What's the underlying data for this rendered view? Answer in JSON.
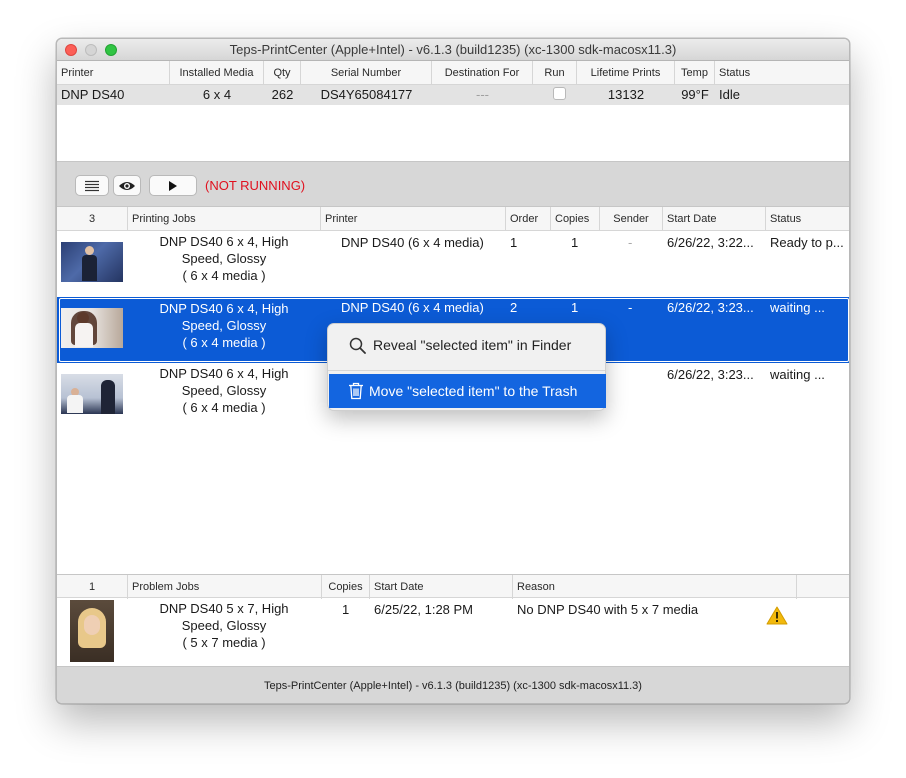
{
  "window": {
    "title": "Teps-PrintCenter (Apple+Intel) - v6.1.3  (build1235)  (xc-1300 sdk-macosx11.3)"
  },
  "printers_table": {
    "headers": [
      "Printer",
      "Installed Media",
      "Qty",
      "Serial Number",
      "Destination For",
      "Run",
      "Lifetime Prints",
      "Temp",
      "Status"
    ],
    "row": {
      "printer": "DNP DS40",
      "media": "6 x 4",
      "qty": "262",
      "serial": "DS4Y65084177",
      "destination": "---",
      "run": false,
      "lifetime": "13132",
      "temp": "99°F",
      "status": "Idle"
    }
  },
  "toolbar": {
    "list_icon": "list-icon",
    "eye_icon": "eye-icon",
    "play_icon": "play-icon",
    "status_text": "(NOT RUNNING)",
    "status_color": "#e0101e"
  },
  "jobs_table": {
    "count": "3",
    "headers": [
      "Printing Jobs",
      "Printer",
      "Order",
      "Copies",
      "Sender",
      "Start Date",
      "Status"
    ],
    "rows": [
      {
        "line1": "DNP DS40 6 x 4, High",
        "line2": "Speed, Glossy",
        "line3": "( 6 x 4 media )",
        "printer": "DNP DS40 (6 x 4 media)",
        "order": "1",
        "copies": "1",
        "sender": "-",
        "start": "6/26/22, 3:22...",
        "status": "Ready to p..."
      },
      {
        "line1": "DNP DS40 6 x 4, High",
        "line2": "Speed, Glossy",
        "line3": "( 6 x 4 media )",
        "printer": "DNP DS40 (6 x 4 media)",
        "order": "2",
        "copies": "1",
        "sender": "-",
        "start": "6/26/22, 3:23...",
        "status": "waiting ..."
      },
      {
        "line1": "DNP DS40 6 x 4, High",
        "line2": "Speed, Glossy",
        "line3": "( 6 x 4 media )",
        "start": "6/26/22, 3:23...",
        "status": "waiting ..."
      }
    ]
  },
  "context_menu": {
    "reveal_icon": "magnifier-icon",
    "reveal_label": "Reveal \"selected item\" in Finder",
    "trash_icon": "trash-icon",
    "trash_label": "Move \"selected item\" to the Trash"
  },
  "problems_table": {
    "count": "1",
    "headers": [
      "Problem Jobs",
      "Copies",
      "Start Date",
      "Reason"
    ],
    "row": {
      "line1": "DNP DS40 5 x 7, High",
      "line2": "Speed, Glossy",
      "line3": "( 5 x 7 media )",
      "copies": "1",
      "start": "6/25/22, 1:28 PM",
      "reason": "No DNP DS40 with 5 x 7 media",
      "warning_icon": "warning-icon"
    }
  },
  "footer": {
    "text": "Teps-PrintCenter (Apple+Intel) - v6.1.3  (build1235)  (xc-1300 sdk-macosx11.3)"
  },
  "colors": {
    "selection": "#0c5bd6",
    "menu_highlight": "#1365e0",
    "warning": "#f2b90c"
  }
}
